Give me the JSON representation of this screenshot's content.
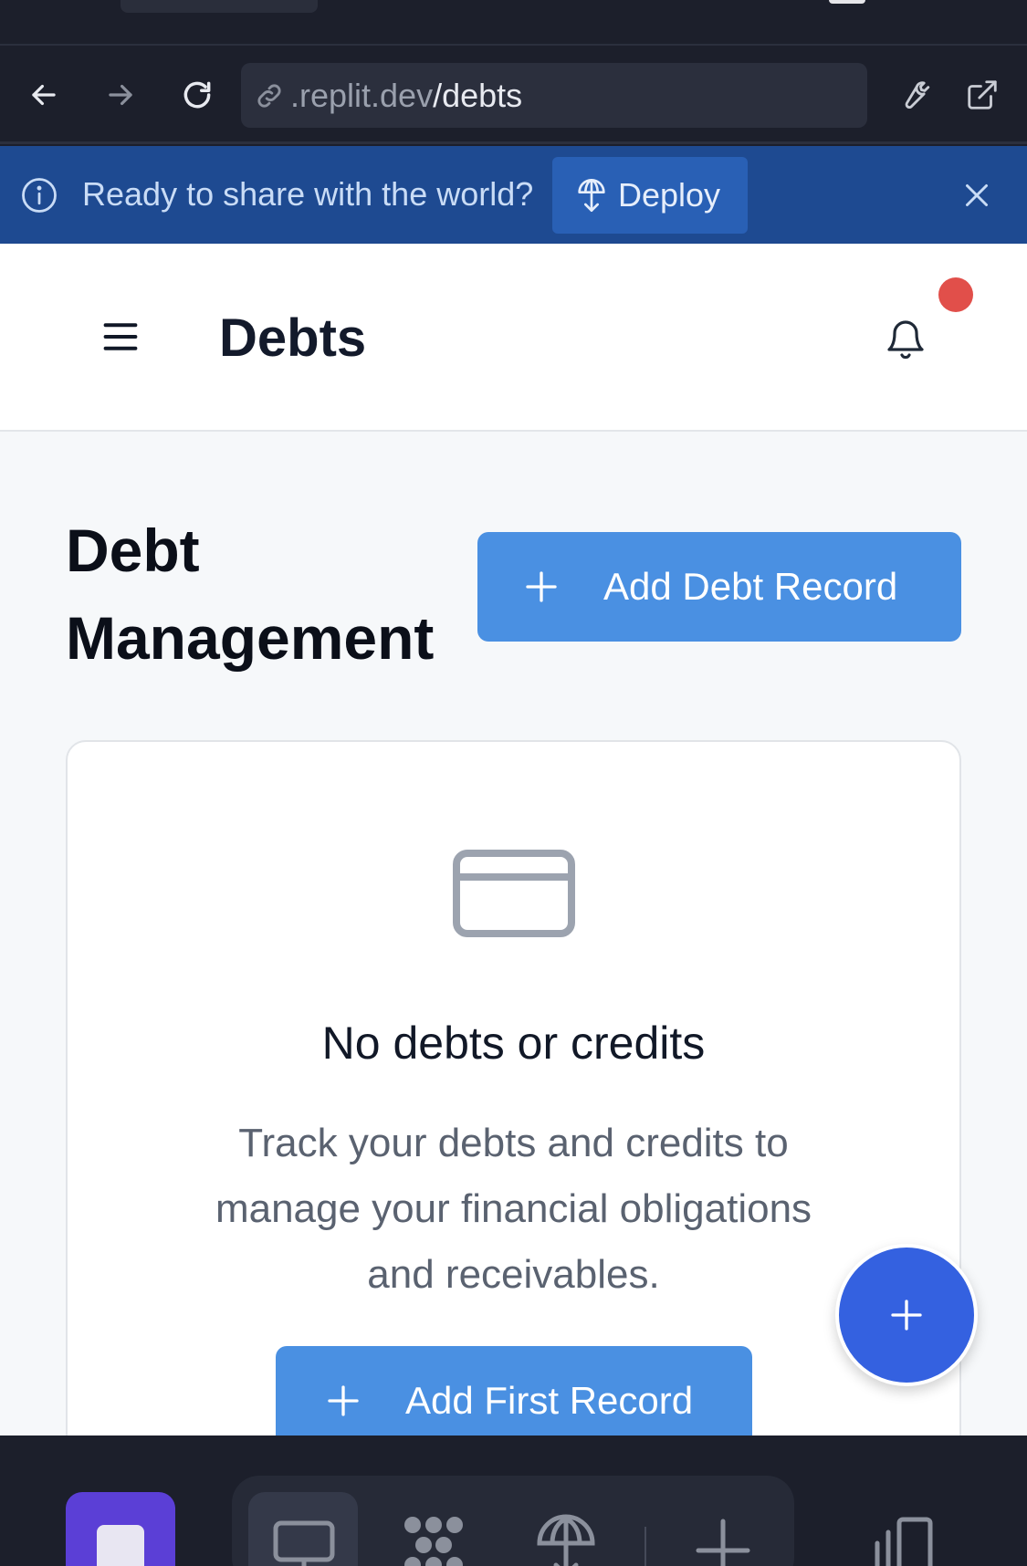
{
  "browser": {
    "url_domain": ".replit.dev",
    "url_path": "/debts",
    "icons": [
      "back-arrow-icon",
      "forward-arrow-icon",
      "reload-icon",
      "link-icon",
      "wrench-icon",
      "open-external-icon"
    ]
  },
  "banner": {
    "text": "Ready to share with the world?",
    "deploy_label": "Deploy",
    "icons": [
      "info-icon",
      "deploy-icon",
      "close-icon"
    ]
  },
  "header": {
    "title": "Debts",
    "has_notification": true,
    "icons": [
      "hamburger-menu-icon",
      "bell-icon"
    ]
  },
  "main": {
    "page_title": "Debt Management",
    "add_debt_label": "Add Debt Record",
    "empty_state": {
      "icon": "credit-card-icon",
      "title": "No debts or credits",
      "description": "Track your debts and credits to manage your financial obligations and receivables.",
      "add_first_label": "Add First Record"
    },
    "fab_icon": "plus-icon"
  },
  "dock": {
    "icons": [
      "app-icon",
      "preview-monitor-icon",
      "agent-icon",
      "deployments-icon",
      "add-tab-icon",
      "layout-icon"
    ]
  },
  "colors": {
    "primary_button": "#4a90e2",
    "fab": "#3461e0",
    "banner": "#1e4a91",
    "notification": "#e14f4a",
    "dock_app": "#5b3fd6"
  }
}
